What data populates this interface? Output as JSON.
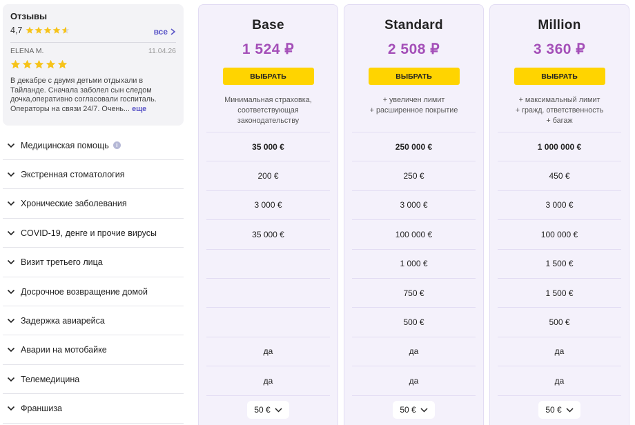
{
  "reviews": {
    "title": "Отзывы",
    "rating": "4,7",
    "all_label": "все",
    "review": {
      "author": "ELENA M.",
      "date": "11.04.26",
      "text": "В декабре с двумя детьми отдыхали в Тайланде. Сначала заболел сын следом дочка,оперативно согласовали госпиталь. Операторы на связи 24/7. Очень...",
      "more_label": "еще"
    }
  },
  "rows": [
    {
      "label": "Медицинская помощь"
    },
    {
      "label": "Экстренная стоматология"
    },
    {
      "label": "Хронические заболевания"
    },
    {
      "label": "COVID-19, денге и прочие вирусы"
    },
    {
      "label": "Визит третьего лица"
    },
    {
      "label": "Досрочное возвращение домой"
    },
    {
      "label": "Задержка авиарейса"
    },
    {
      "label": "Аварии на мотобайке"
    },
    {
      "label": "Телемедицина"
    },
    {
      "label": "Франшиза"
    }
  ],
  "plans": [
    {
      "name": "Base",
      "price": "1 524 ₽",
      "button": "ВЫБРАТЬ",
      "desc": [
        "Минимальная страховка,",
        "соответствующая",
        "законодательству"
      ],
      "values": [
        "35 000 €",
        "200 €",
        "3 000 €",
        "35 000 €",
        "",
        "",
        "",
        "да",
        "да"
      ],
      "deductible": "50 €"
    },
    {
      "name": "Standard",
      "price": "2 508 ₽",
      "button": "ВЫБРАТЬ",
      "desc": [
        "+ увеличен лимит",
        "+ расширенное покрытие"
      ],
      "values": [
        "250 000 €",
        "250 €",
        "3 000 €",
        "100 000 €",
        "1 000 €",
        "750 €",
        "500 €",
        "да",
        "да"
      ],
      "deductible": "50 €"
    },
    {
      "name": "Million",
      "price": "3 360 ₽",
      "button": "ВЫБРАТЬ",
      "desc": [
        "+ максимальный лимит",
        "+ гражд. ответственность",
        "+ багаж"
      ],
      "values": [
        "1 000 000 €",
        "450 €",
        "3 000 €",
        "100 000 €",
        "1 500 €",
        "1 500 €",
        "500 €",
        "да",
        "да"
      ],
      "deductible": "50 €"
    }
  ],
  "colors": {
    "accent": "#a44fb8",
    "button": "#ffd400",
    "link": "#5a55c7",
    "star": "#f6c31a",
    "plan_bg": "#f4f1fb"
  },
  "icons": {
    "star": "star-icon",
    "chevron": "chevron-down-icon",
    "info": "info-icon",
    "arrow": "chevron-right-icon"
  }
}
